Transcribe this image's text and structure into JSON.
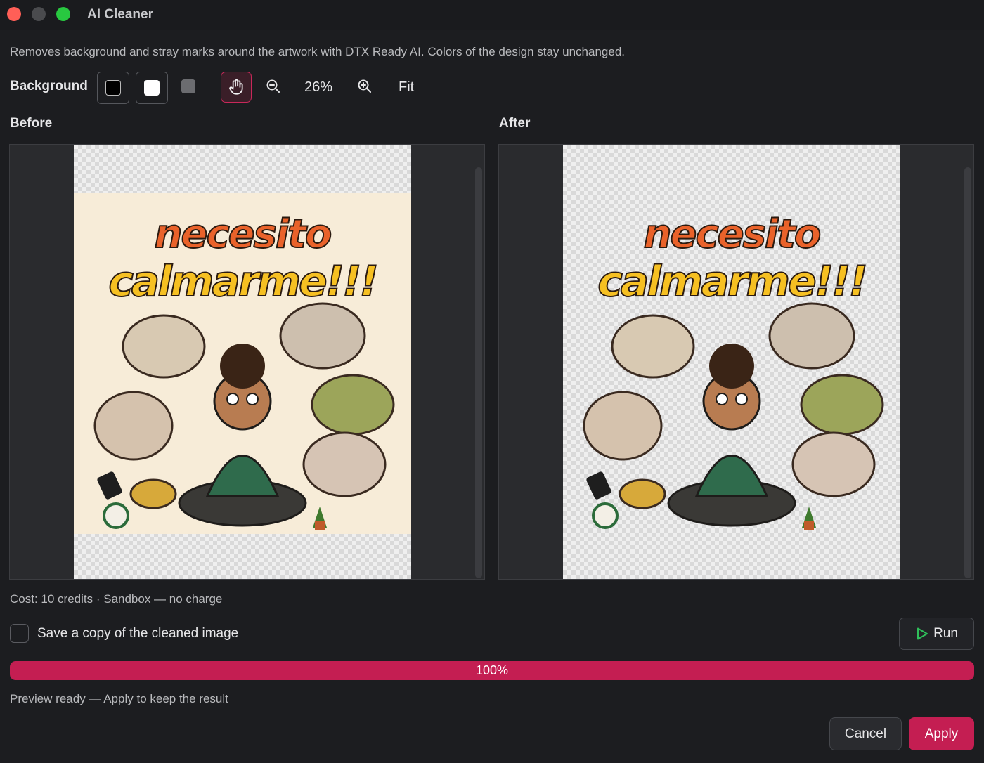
{
  "window": {
    "title": "AI Cleaner"
  },
  "description": "Removes background and stray marks around the artwork with DTX Ready AI. Colors of the design stay unchanged.",
  "toolbar": {
    "background_label": "Background",
    "zoom_value": "26%",
    "fit_label": "Fit"
  },
  "panes": {
    "before_label": "Before",
    "after_label": "After",
    "artwork_line1": "necesito",
    "artwork_line2": "calmarme!!!"
  },
  "cost_text": "Cost: 10 credits · Sandbox — no charge",
  "save_copy": {
    "label": "Save a copy of the cleaned image",
    "checked": false
  },
  "run_label": "Run",
  "progress": {
    "value": 100,
    "text": "100%"
  },
  "status_text": "Preview ready — Apply to keep the result",
  "buttons": {
    "cancel": "Cancel",
    "apply": "Apply"
  },
  "colors": {
    "accent": "#c41e52",
    "background": "#1c1d20"
  }
}
